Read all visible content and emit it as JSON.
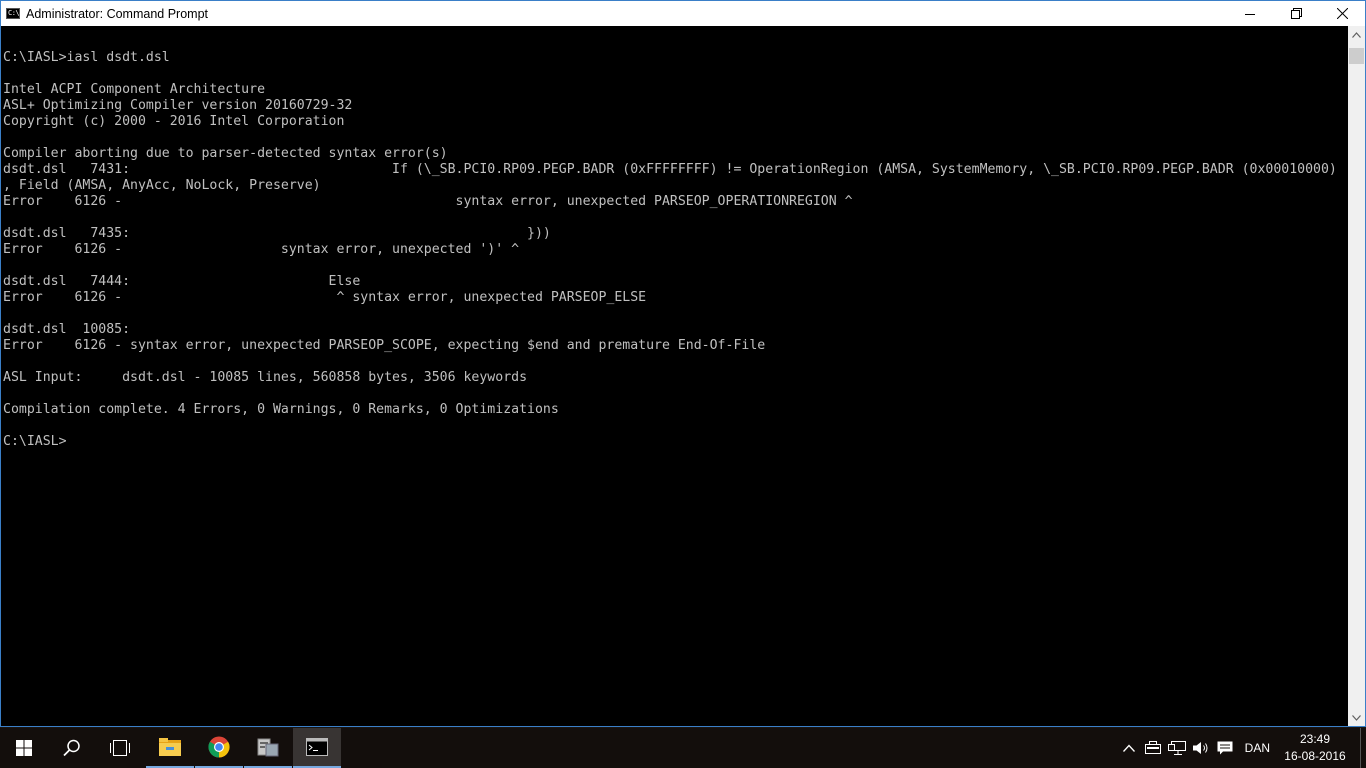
{
  "window": {
    "title": "Administrator: Command Prompt",
    "icon_label": "C:\\"
  },
  "console": {
    "lines": [
      "",
      "C:\\IASL>iasl dsdt.dsl",
      "",
      "Intel ACPI Component Architecture",
      "ASL+ Optimizing Compiler version 20160729-32",
      "Copyright (c) 2000 - 2016 Intel Corporation",
      "",
      "Compiler aborting due to parser-detected syntax error(s)",
      "dsdt.dsl   7431:                                 If (\\_SB.PCI0.RP09.PEGP.BADR (0xFFFFFFFF) != OperationRegion (AMSA, SystemMemory, \\_SB.PCI0.RP09.PEGP.BADR (0x00010000)",
      ", Field (AMSA, AnyAcc, NoLock, Preserve)",
      "Error    6126 -                                          syntax error, unexpected PARSEOP_OPERATIONREGION ^",
      "",
      "dsdt.dsl   7435:                                                  }))",
      "Error    6126 -                    syntax error, unexpected ')' ^",
      "",
      "dsdt.dsl   7444:                         Else",
      "Error    6126 -                           ^ syntax error, unexpected PARSEOP_ELSE",
      "",
      "dsdt.dsl  10085:",
      "Error    6126 - syntax error, unexpected PARSEOP_SCOPE, expecting $end and premature End-Of-File",
      "",
      "ASL Input:     dsdt.dsl - 10085 lines, 560858 bytes, 3506 keywords",
      "",
      "Compilation complete. 4 Errors, 0 Warnings, 0 Remarks, 0 Optimizations",
      "",
      "C:\\IASL>"
    ]
  },
  "taskbar": {
    "apps": [
      {
        "name": "start-button",
        "icon": "windows-logo-icon"
      },
      {
        "name": "search-button",
        "icon": "search-icon"
      },
      {
        "name": "task-view-button",
        "icon": "task-view-icon"
      },
      {
        "name": "file-explorer",
        "icon": "folder-icon"
      },
      {
        "name": "chrome",
        "icon": "chrome-icon"
      },
      {
        "name": "app-generic",
        "icon": "app-icon"
      },
      {
        "name": "command-prompt",
        "icon": "cmd-icon"
      }
    ],
    "language": "DAN",
    "time": "23:49",
    "date": "16-08-2016"
  },
  "colors": {
    "console_bg": "#000000",
    "console_fg": "#c0c0c0",
    "window_border": "#3a7fc8",
    "taskbar_accent": "#76a8e0"
  }
}
